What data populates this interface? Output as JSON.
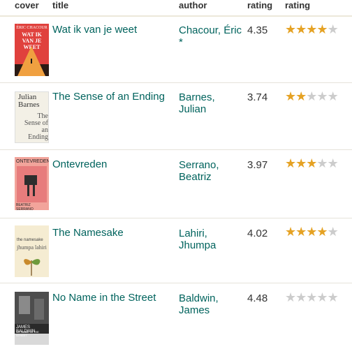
{
  "columns": [
    "cover",
    "title",
    "author",
    "rating",
    "rating"
  ],
  "rows": [
    {
      "title": "Wat ik van je weet",
      "author": "Chacour, Éric *",
      "rating": "4.35",
      "stars": 4,
      "cover": {
        "top": "ÉRIC CHACOUR",
        "main": "WAT IK VAN JE WEET"
      }
    },
    {
      "title": "The Sense of an Ending",
      "author": "Barnes, Julian",
      "rating": "3.74",
      "stars": 2,
      "cover": {
        "top": "Julian Barnes",
        "main": "The Sense of an Ending"
      }
    },
    {
      "title": "Ontevreden",
      "author": "Serrano, Beatriz",
      "rating": "3.97",
      "stars": 3,
      "cover": {
        "top": "ONTEVREDEN",
        "main": "BEATRIZ SERRANO"
      }
    },
    {
      "title": "The Namesake",
      "author": "Lahiri, Jhumpa",
      "rating": "4.02",
      "stars": 4,
      "cover": {
        "top": "the namesake",
        "main": "jhumpa lahiri"
      }
    },
    {
      "title": "No Name in the Street",
      "author": "Baldwin, James",
      "rating": "4.48",
      "stars": 0,
      "cover": {
        "top": "JAMES BALDWIN",
        "main": "NO NAME IN THE STREET"
      }
    }
  ],
  "colors": {
    "link": "#00635d",
    "star_on": "#e5a224",
    "star_off": "#cccccc"
  }
}
